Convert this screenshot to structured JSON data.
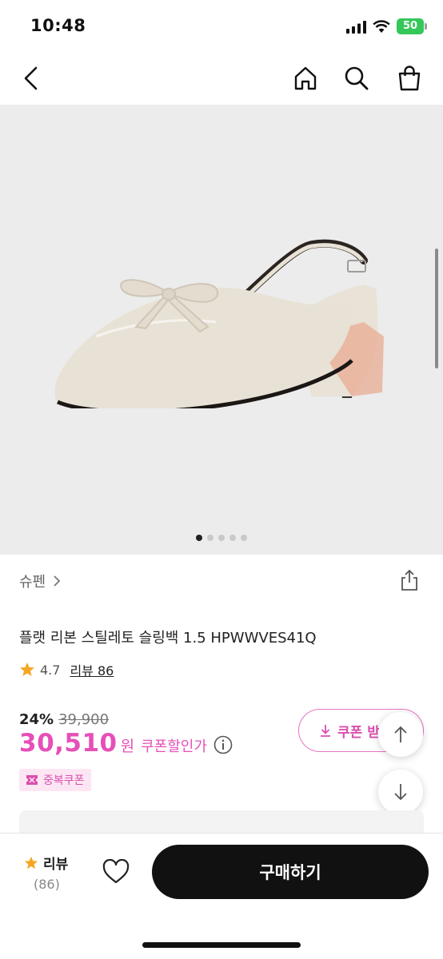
{
  "status": {
    "time": "10:48",
    "battery": "50"
  },
  "nav": {
    "icons": [
      "chevron-left-icon",
      "home-icon",
      "search-icon",
      "shopping-bag-icon"
    ]
  },
  "gallery": {
    "dots_total": 5,
    "active_index": 0
  },
  "product": {
    "brand": "슈펜",
    "title": "플랫 리본 스틸레토 슬링백 1.5 HPWWVES41Q",
    "rating": "4.7",
    "review_label": "리뷰 86",
    "discount_rate": "24%",
    "original_price": "39,900",
    "price": "30,510",
    "price_unit": "원",
    "price_label": "쿠폰할인가",
    "coupon_button": "쿠폰 받",
    "badge": "중복쿠폰"
  },
  "bottom_bar": {
    "review_label": "리뷰",
    "review_count": "(86)",
    "buy_label": "구매하기"
  },
  "colors": {
    "accent": "#e64fb8",
    "star": "#f5a623",
    "buy_button": "#111111"
  }
}
